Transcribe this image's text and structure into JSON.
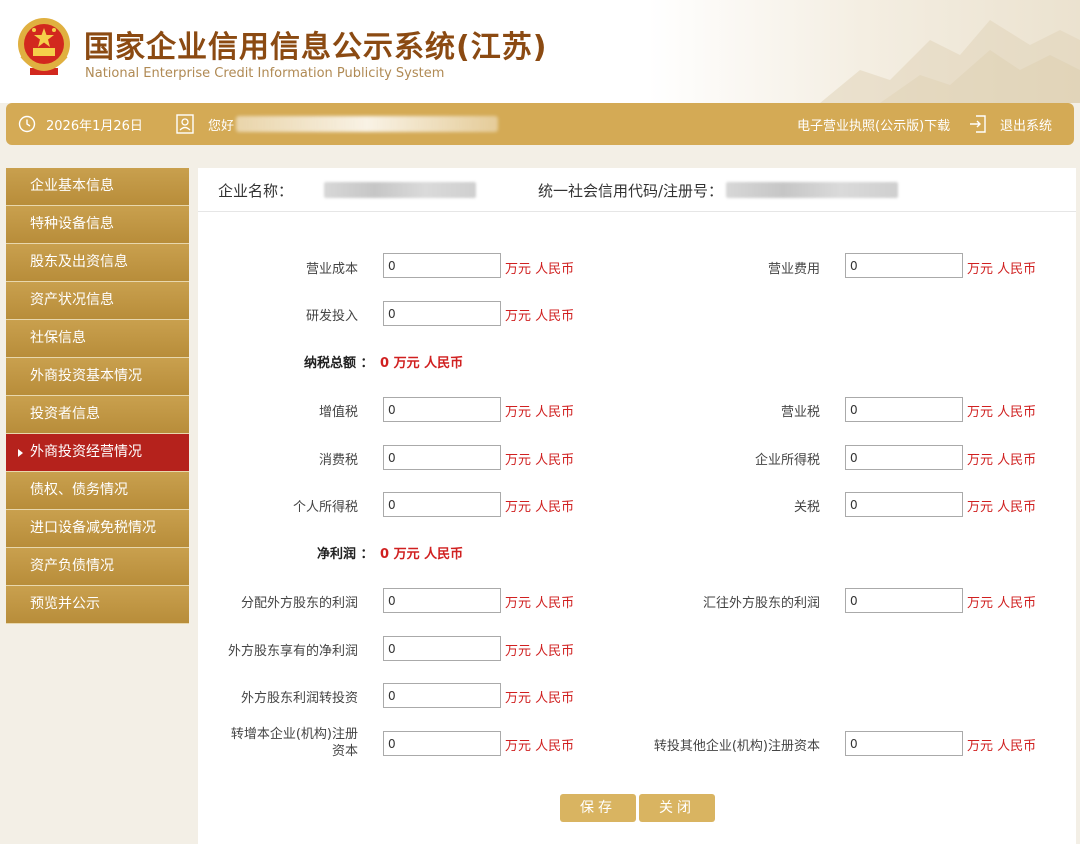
{
  "header": {
    "title_cn": "国家企业信用信息公示系统(江苏)",
    "title_en": "National Enterprise Credit Information Publicity System"
  },
  "topbar": {
    "date": "2026年1月26日",
    "greeting": "您好",
    "license_download": "电子营业执照(公示版)下载",
    "logout": "退出系统"
  },
  "sidebar": {
    "items": [
      {
        "label": "企业基本信息"
      },
      {
        "label": "特种设备信息"
      },
      {
        "label": "股东及出资信息"
      },
      {
        "label": "资产状况信息"
      },
      {
        "label": "社保信息"
      },
      {
        "label": "外商投资基本情况"
      },
      {
        "label": "投资者信息"
      },
      {
        "label": "外商投资经营情况",
        "active": true
      },
      {
        "label": "债权、债务情况"
      },
      {
        "label": "进口设备减免税情况"
      },
      {
        "label": "资产负债情况"
      },
      {
        "label": "预览并公示"
      }
    ]
  },
  "info": {
    "company_name_label": "企业名称：",
    "credit_code_label": "统一社会信用代码/注册号："
  },
  "unit_text": "万元 人民币",
  "fields": {
    "operating_cost": {
      "label": "营业成本",
      "value": "0"
    },
    "operating_expense": {
      "label": "营业费用",
      "value": "0"
    },
    "rd_investment": {
      "label": "研发投入",
      "value": "0"
    },
    "vat": {
      "label": "增值税",
      "value": "0"
    },
    "business_tax": {
      "label": "营业税",
      "value": "0"
    },
    "consumption_tax": {
      "label": "消费税",
      "value": "0"
    },
    "corporate_income_tax": {
      "label": "企业所得税",
      "value": "0"
    },
    "personal_income_tax": {
      "label": "个人所得税",
      "value": "0"
    },
    "customs_duty": {
      "label": "关税",
      "value": "0"
    },
    "profit_distributed_foreign": {
      "label": "分配外方股东的利润",
      "value": "0"
    },
    "profit_remitted_foreign": {
      "label": "汇往外方股东的利润",
      "value": "0"
    },
    "foreign_net_profit": {
      "label": "外方股东享有的净利润",
      "value": "0"
    },
    "foreign_profit_reinvest": {
      "label": "外方股东利润转投资",
      "value": "0"
    },
    "reinvest_own_capital": {
      "label": "转增本企业(机构)注册资本",
      "value": "0"
    },
    "reinvest_other_capital": {
      "label": "转投其他企业(机构)注册资本",
      "value": "0"
    }
  },
  "totals": {
    "tax_total_label": "纳税总额 ：",
    "tax_total_value": "0 万元 人民币",
    "net_profit_label": "净利润 ：",
    "net_profit_value": "0 万元 人民币"
  },
  "buttons": {
    "save": "保存",
    "close": "关闭"
  },
  "colors": {
    "gold": "#d4aa55",
    "sidebar_gold": "#c39a48",
    "active_red": "#b5221c",
    "unit_red": "#d02020",
    "title_brown": "#8b4a12"
  }
}
